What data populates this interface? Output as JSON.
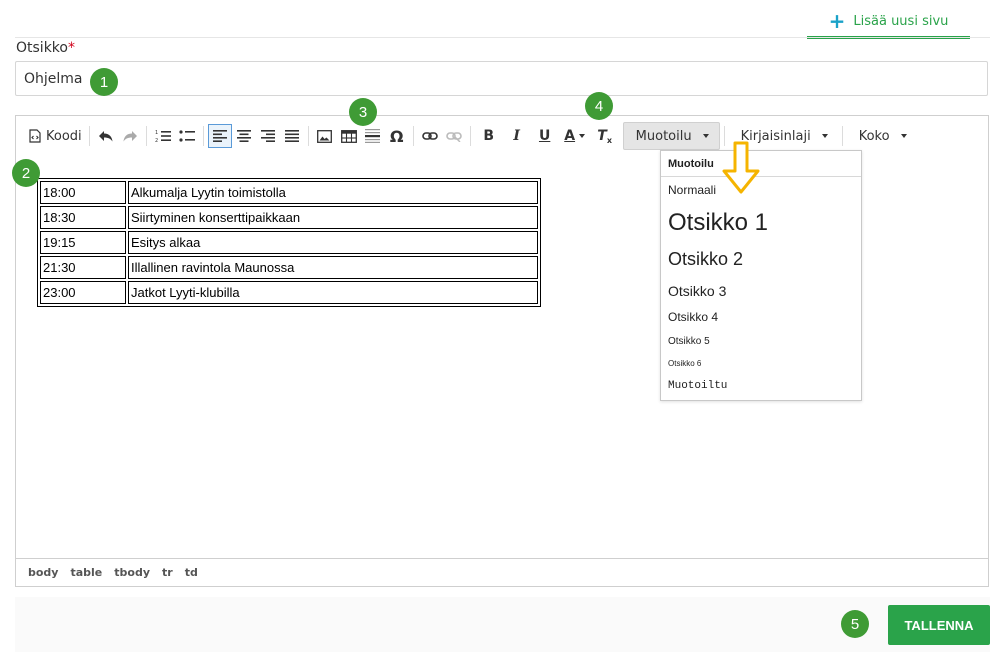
{
  "tabs": {
    "add_page": "Lisää uusi sivu"
  },
  "title_field": {
    "label": "Otsikko",
    "required_mark": "*",
    "value": "Ohjelma"
  },
  "toolbar": {
    "code_label": "Koodi",
    "format_dropdown": "Muotoilu",
    "font_dropdown": "Kirjaisinlaji",
    "size_dropdown": "Koko",
    "bold": "B",
    "italic": "I",
    "underline": "U",
    "text_color": "A",
    "clear_format": "T",
    "special_char": "Ω"
  },
  "schedule": [
    {
      "time": "18:00",
      "event": "Alkumalja Lyytin toimistolla"
    },
    {
      "time": "18:30",
      "event": "Siirtyminen konserttipaikkaan"
    },
    {
      "time": "19:15",
      "event": "Esitys alkaa"
    },
    {
      "time": "21:30",
      "event": "Illallinen ravintola Maunossa"
    },
    {
      "time": "23:00",
      "event": "Jatkot Lyyti-klubilla"
    }
  ],
  "format_menu": {
    "header": "Muotoilu",
    "items": [
      "Normaali",
      "Otsikko 1",
      "Otsikko 2",
      "Otsikko 3",
      "Otsikko 4",
      "Otsikko 5",
      "Otsikko 6",
      "Muotoiltu"
    ]
  },
  "statusbar": [
    "body",
    "table",
    "tbody",
    "tr",
    "td"
  ],
  "badges": [
    "1",
    "2",
    "3",
    "4",
    "5"
  ],
  "save_button": "TALLENNA",
  "colors": {
    "accent_green": "#2aa34a",
    "badge_green": "#3f9b35",
    "arrow_yellow": "#f5b400",
    "plus_blue": "#1aa2c8"
  }
}
